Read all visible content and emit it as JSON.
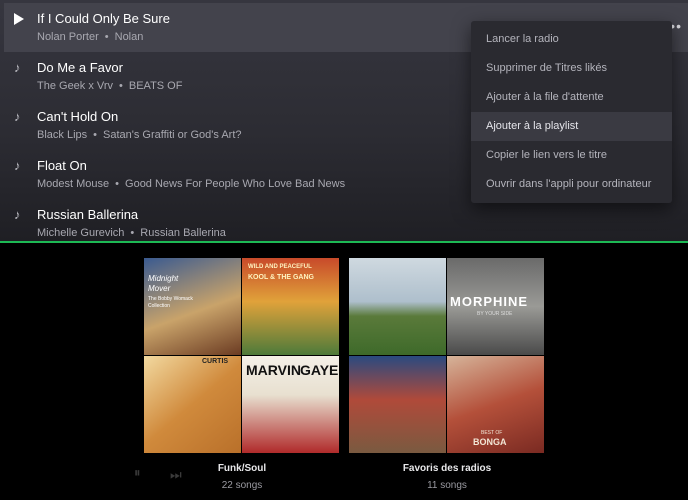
{
  "tracks": [
    {
      "title": "If I Could Only Be Sure",
      "artist": "Nolan Porter",
      "album": "Nolan"
    },
    {
      "title": "Do Me a Favor",
      "artist": "The Geek x Vrv",
      "album": "BEATS OF"
    },
    {
      "title": "Can't Hold On",
      "artist": "Black Lips",
      "album": "Satan's Graffiti or God's Art?"
    },
    {
      "title": "Float On",
      "artist": "Modest Mouse",
      "album": "Good News For People Who Love Bad News"
    },
    {
      "title": "Russian Ballerina",
      "artist": "Michelle Gurevich",
      "album": "Russian Ballerina"
    }
  ],
  "separator": "•",
  "more_label": "•••",
  "context_menu": {
    "items": [
      "Lancer la radio",
      "Supprimer de Titres likés",
      "Ajouter à la file d'attente",
      "Ajouter à la playlist",
      "Copier le lien vers le titre",
      "Ouvrir dans l'appli pour ordinateur"
    ],
    "hovered": "Ajouter à la playlist"
  },
  "playlists": [
    {
      "name": "Funk/Soul",
      "count": "22 songs",
      "covers": [
        {
          "lines": [
            "Midnight",
            "Mover",
            "The Bobby Womack",
            "Collection"
          ]
        },
        {
          "lines": [
            "WILD AND PEACEFUL",
            "KOOL & THE GANG"
          ]
        },
        {
          "lines": [
            "CURTIS"
          ]
        },
        {
          "lines": [
            "MARVIN",
            "GAYE"
          ]
        }
      ]
    },
    {
      "name": "Favoris des radios",
      "count": "11 songs",
      "covers": [
        {
          "lines": []
        },
        {
          "lines": [
            "MORPHINE",
            "BY YOUR SIDE"
          ]
        },
        {
          "lines": []
        },
        {
          "lines": [
            "BEST OF",
            "BONGA"
          ]
        }
      ]
    }
  ],
  "colors": {
    "accent": "#1db954"
  }
}
